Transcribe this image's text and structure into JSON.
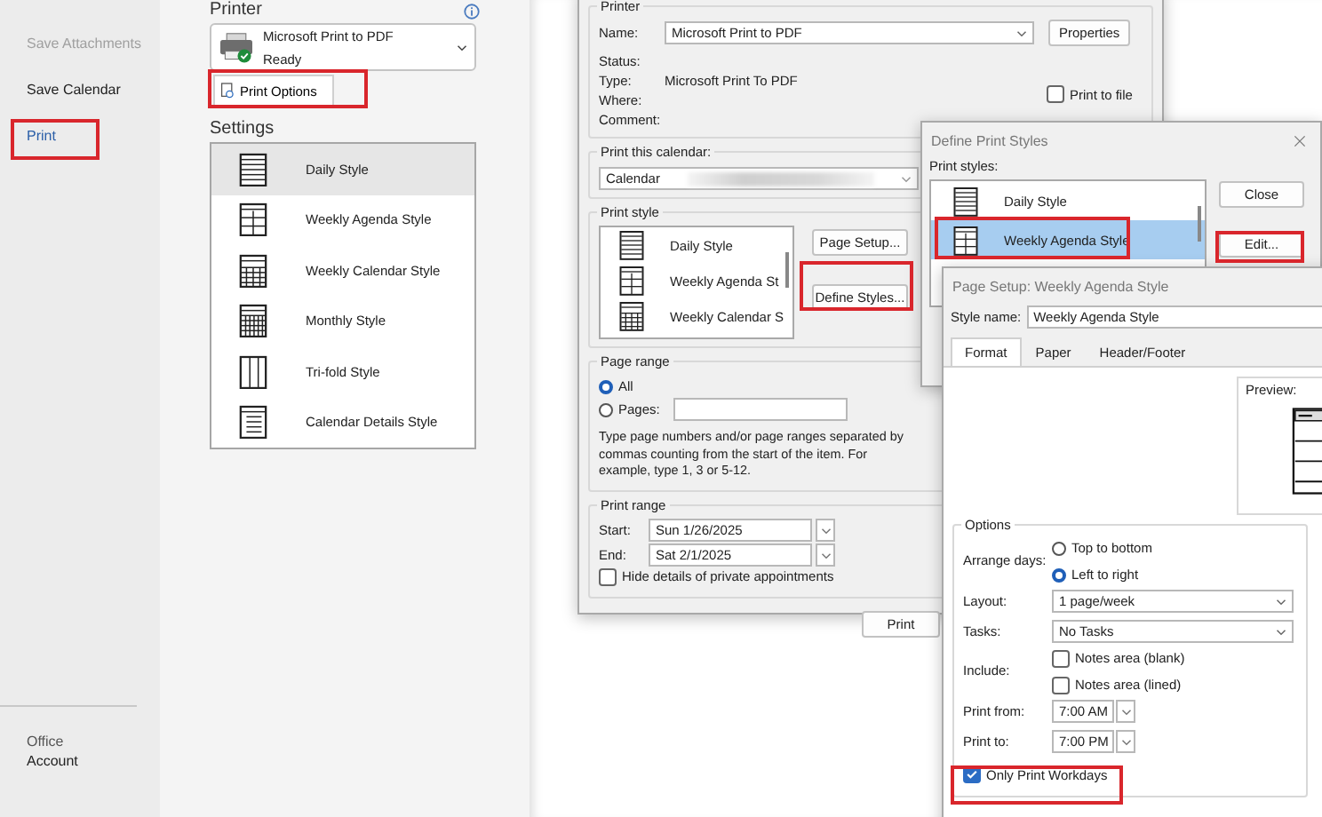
{
  "backstage_nav": {
    "items": [
      {
        "label": "Save Attachments",
        "disabled": true,
        "selected": false
      },
      {
        "label": "Save Calendar",
        "disabled": false,
        "selected": false
      },
      {
        "label": "Print",
        "disabled": false,
        "selected": true
      }
    ],
    "account_link": {
      "product": "Office",
      "label": "Account"
    }
  },
  "print_panel": {
    "printer_heading": "Printer",
    "printer": {
      "name": "Microsoft Print to PDF",
      "status": "Ready"
    },
    "print_options_button": "Print Options",
    "settings_heading": "Settings",
    "styles": [
      {
        "label": "Daily Style",
        "kind": "daily",
        "selected": true
      },
      {
        "label": "Weekly Agenda Style",
        "kind": "agenda",
        "selected": false
      },
      {
        "label": "Weekly Calendar Style",
        "kind": "calendar",
        "selected": false
      },
      {
        "label": "Monthly Style",
        "kind": "monthly",
        "selected": false
      },
      {
        "label": "Tri-fold Style",
        "kind": "trifold",
        "selected": false
      },
      {
        "label": "Calendar Details Style",
        "kind": "details",
        "selected": false
      }
    ]
  },
  "print_dialog": {
    "printer_group": "Printer",
    "name_label": "Name:",
    "name_value": "Microsoft Print to PDF",
    "properties_button": "Properties",
    "info_rows": [
      {
        "label": "Status:"
      },
      {
        "label": "Type:",
        "value": "Microsoft Print To PDF"
      },
      {
        "label": "Where:"
      },
      {
        "label": "Comment:"
      }
    ],
    "print_to_file": {
      "label": "Print to file",
      "checked": false
    },
    "calendar_group": "Print this calendar:",
    "calendar_value": "Calendar",
    "style_group": "Print style",
    "styles": [
      {
        "label": "Daily Style",
        "kind": "daily"
      },
      {
        "label": "Weekly Agenda St",
        "kind": "agenda"
      },
      {
        "label": "Weekly Calendar S",
        "kind": "calendar"
      }
    ],
    "page_setup_button": "Page Setup...",
    "define_styles_button": "Define Styles...",
    "page_range_group": "Page range",
    "page_range_options": [
      {
        "label": "All",
        "selected": true
      },
      {
        "label": "Pages:",
        "selected": false
      }
    ],
    "page_range_hint": "Type page numbers and/or page ranges separated by commas counting from the start of the item.  For example, type 1, 3 or 5-12.",
    "print_range_group": "Print range",
    "range_fields": [
      {
        "label": "Start:",
        "value": "Sun 1/26/2025"
      },
      {
        "label": "End:",
        "value": "Sat 2/1/2025"
      }
    ],
    "hide_private": {
      "label": "Hide details of private appointments",
      "checked": false
    },
    "print_button": "Print"
  },
  "define_styles": {
    "title": "Define Print Styles",
    "list_label": "Print styles:",
    "styles": [
      {
        "label": "Daily Style",
        "kind": "daily",
        "selected": false
      },
      {
        "label": "Weekly Agenda Style",
        "kind": "agenda",
        "selected": true
      }
    ],
    "close_button": "Close",
    "edit_button": "Edit..."
  },
  "page_setup": {
    "title": "Page Setup: Weekly Agenda Style",
    "style_name_label": "Style name:",
    "style_name": "Weekly Agenda Style",
    "tabs": [
      {
        "label": "Format",
        "selected": true
      },
      {
        "label": "Paper",
        "selected": false
      },
      {
        "label": "Header/Footer",
        "selected": false
      }
    ],
    "preview_label": "Preview:",
    "options_group": "Options",
    "arrange_label": "Arrange days:",
    "arrange_options": [
      {
        "label": "Top to bottom",
        "selected": false
      },
      {
        "label": "Left to right",
        "selected": true
      }
    ],
    "layout_label": "Layout:",
    "layout_value": "1 page/week",
    "tasks_label": "Tasks:",
    "tasks_value": "No Tasks",
    "include_label": "Include:",
    "include_options": [
      {
        "label": "Notes area (blank)",
        "checked": false
      },
      {
        "label": "Notes area (lined)",
        "checked": false
      }
    ],
    "times": [
      {
        "label": "Print from:",
        "value": "7:00 AM"
      },
      {
        "label": "Print to:",
        "value": "7:00 PM"
      }
    ],
    "workdays": {
      "label": "Only Print Workdays",
      "checked": true
    }
  }
}
